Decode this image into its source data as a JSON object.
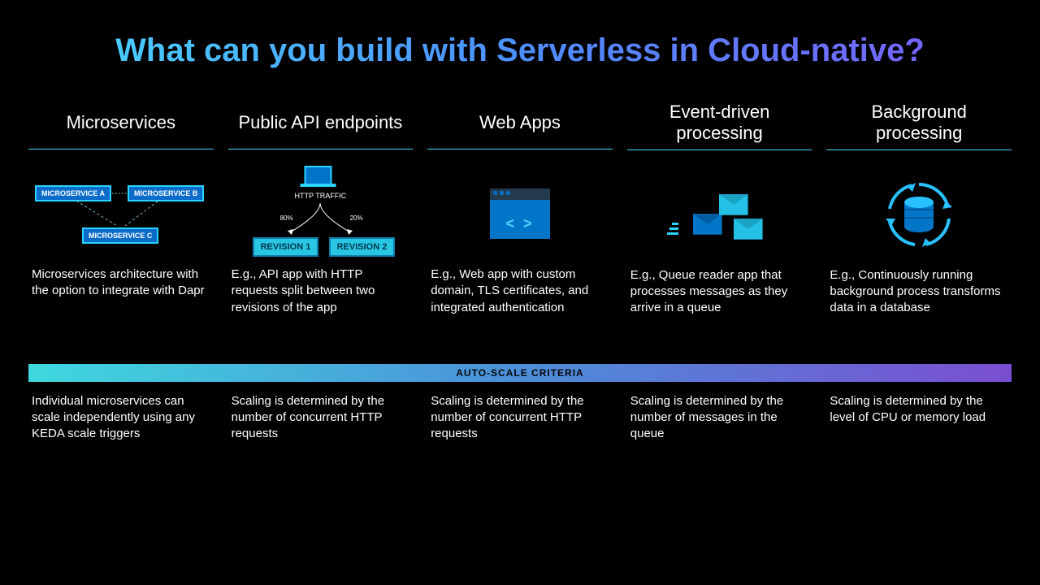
{
  "title": "What can you build with Serverless in Cloud-native?",
  "columns": [
    {
      "header": "Microservices",
      "desc": "Microservices architecture with the option to integrate with Dapr",
      "scale": "Individual microservices can scale independently using any KEDA scale triggers",
      "gfx": {
        "boxA": "MICROSERVICE A",
        "boxB": "MICROSERVICE B",
        "boxC": "MICROSERVICE C"
      }
    },
    {
      "header": "Public API endpoints",
      "desc": "E.g., API app with HTTP requests split between two revisions of the app",
      "scale": "Scaling is determined by the number of concurrent HTTP requests",
      "gfx": {
        "http": "HTTP TRAFFIC",
        "pctA": "80%",
        "pctB": "20%",
        "revA": "REVISION 1",
        "revB": "REVISION 2"
      }
    },
    {
      "header": "Web Apps",
      "desc": "E.g., Web app with custom domain, TLS certificates, and integrated authentication",
      "scale": "Scaling is determined by the number of concurrent HTTP requests"
    },
    {
      "header": "Event-driven processing",
      "desc": "E.g., Queue reader app that processes messages as they arrive in a queue",
      "scale": "Scaling is determined by the number of messages in the queue"
    },
    {
      "header": "Background processing",
      "desc": "E.g., Continuously running background process transforms data in a database",
      "scale": "Scaling is determined by the level of CPU or memory load"
    }
  ],
  "scaleBar": "AUTO-SCALE CRITERIA"
}
